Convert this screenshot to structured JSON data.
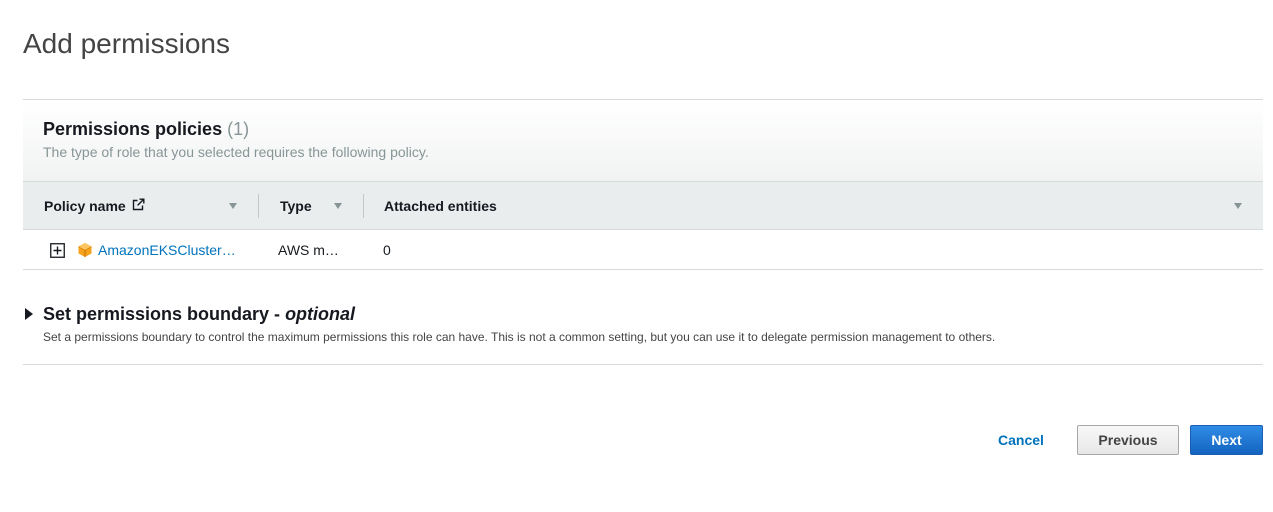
{
  "page": {
    "title": "Add permissions"
  },
  "permissions_policies": {
    "title": "Permissions policies",
    "count": "(1)",
    "description": "The type of role that you selected requires the following policy.",
    "columns": {
      "policy_name": "Policy name",
      "type": "Type",
      "attached_entities": "Attached entities"
    },
    "rows": [
      {
        "policy_name": "AmazonEKSCluster…",
        "type": "AWS m…",
        "attached_entities": "0"
      }
    ]
  },
  "permissions_boundary": {
    "title": "Set permissions boundary - ",
    "title_optional": "optional",
    "description": "Set a permissions boundary to control the maximum permissions this role can have. This is not a common setting, but you can use it to delegate permission management to others."
  },
  "footer": {
    "cancel_label": "Cancel",
    "previous_label": "Previous",
    "next_label": "Next"
  },
  "colors": {
    "link": "#0073bb",
    "primary_button": "#1a6fd0",
    "policy_icon": "#f7a21b"
  }
}
